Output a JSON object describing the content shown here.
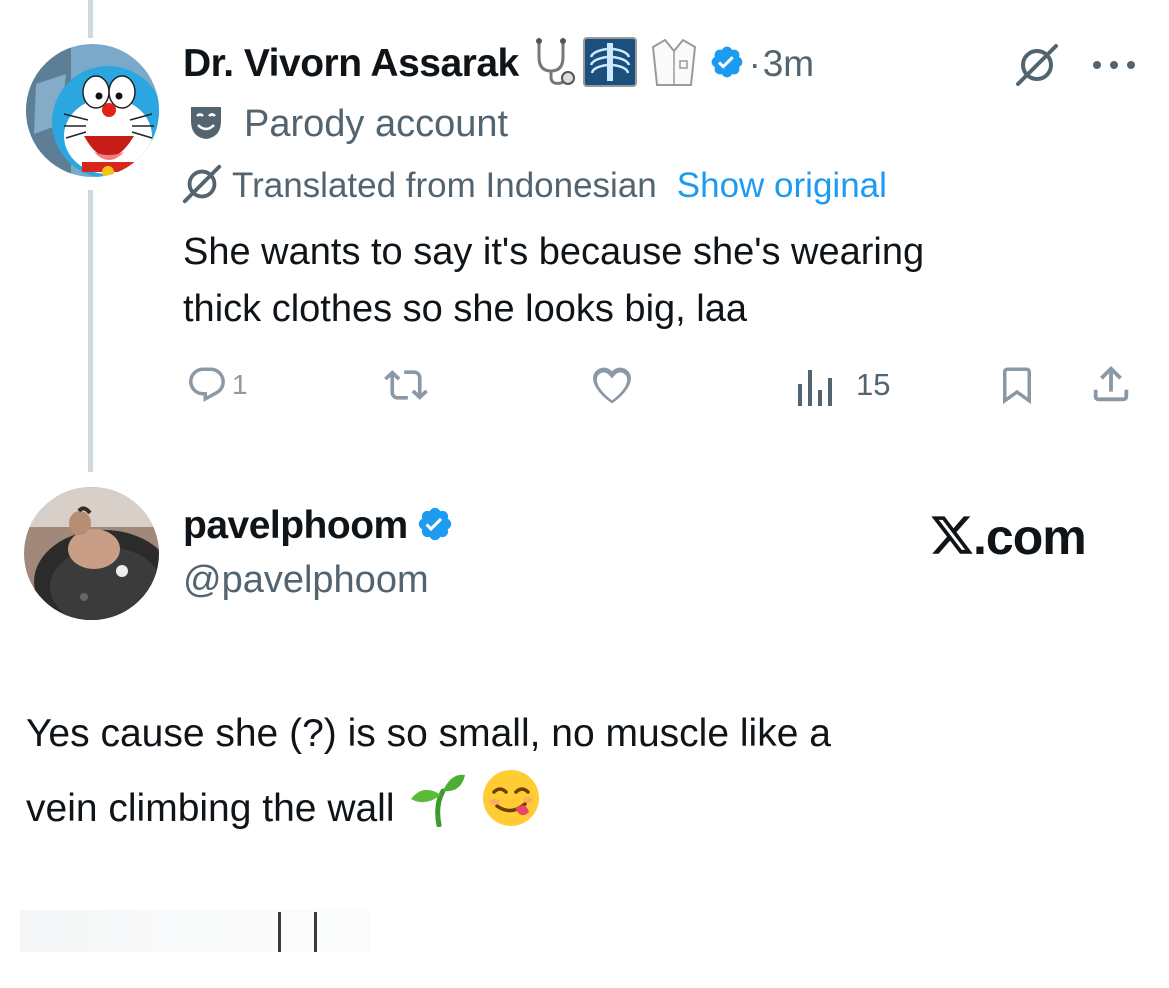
{
  "tweet1": {
    "display_name": "Dr. Vivorn Assarak",
    "time": "3m",
    "dot": "·",
    "label": "Parody account",
    "translated_label": "Translated from Indonesian",
    "show_original": "Show original",
    "text_line1": "She wants to say it's because she's wearing",
    "text_line2": "thick clothes so she looks big, laa",
    "reply_count": "1",
    "views_count": "15",
    "icons": [
      "stethoscope-emoji",
      "xray-emoji",
      "lab-coat-emoji",
      "verified-badge",
      "grok-icon",
      "more-icon",
      "theater-masks-icon",
      "reply-icon",
      "retweet-icon",
      "like-icon",
      "views-icon",
      "bookmark-icon",
      "share-icon"
    ]
  },
  "tweet2": {
    "display_name": "pavelphoom",
    "handle": "@pavelphoom",
    "brand": "X.com",
    "text_line1": "Yes cause she (?) is so small, no muscle like a",
    "text_line2": "vein climbing the wall",
    "icons": [
      "verified-badge",
      "x-logo",
      "seedling-emoji",
      "yum-emoji"
    ]
  },
  "colors": {
    "accent": "#1d9bf0",
    "text": "#0f1419",
    "muted": "#536471",
    "thread_line": "#cfd9de"
  }
}
